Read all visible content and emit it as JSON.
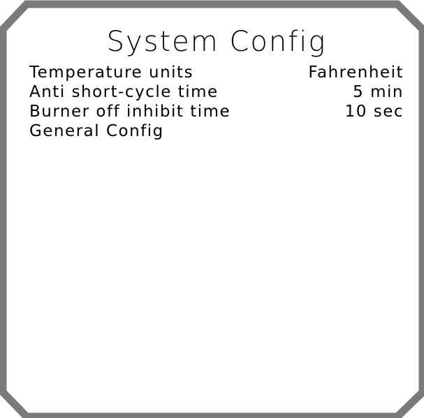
{
  "screen": {
    "title": "System Config",
    "frame_color": "#7a7a7a",
    "background_color": "#ffffff"
  },
  "menu": {
    "items": [
      {
        "label": "Temperature units",
        "value": "Fahrenheit"
      },
      {
        "label": "Anti short-cycle time",
        "value": "5 min"
      },
      {
        "label": "Burner off inhibit time",
        "value": "10 sec"
      },
      {
        "label": "General Config",
        "value": ""
      }
    ]
  }
}
